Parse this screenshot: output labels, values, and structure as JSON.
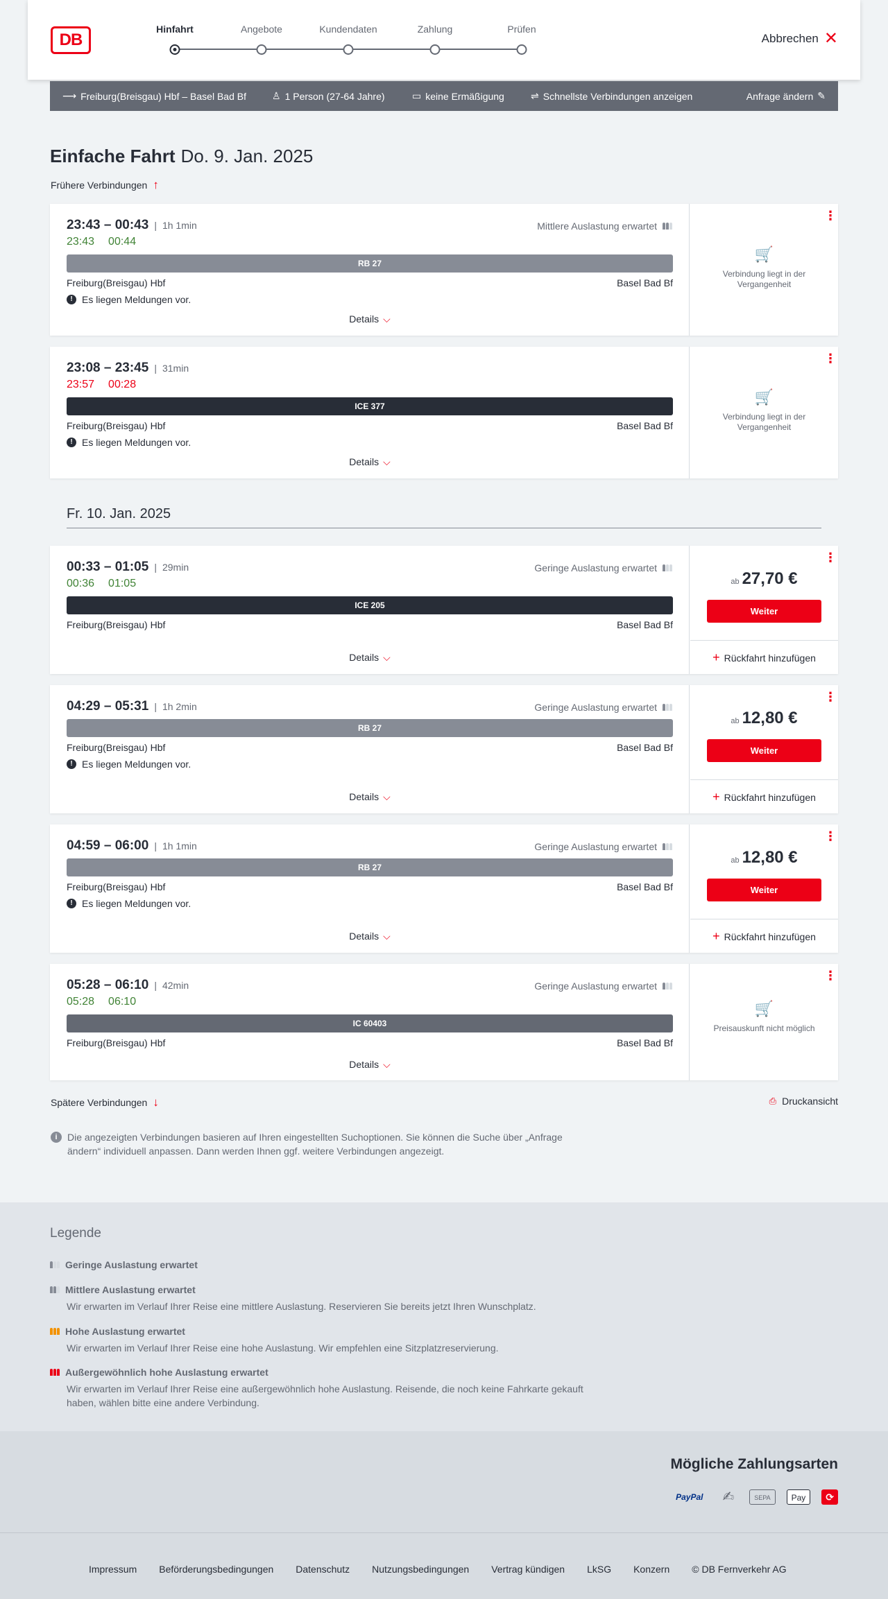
{
  "header": {
    "logo_text": "DB",
    "steps": [
      "Hinfahrt",
      "Angebote",
      "Kundendaten",
      "Zahlung",
      "Prüfen"
    ],
    "cancel_label": "Abbrechen"
  },
  "query": {
    "route": "Freiburg(Breisgau) Hbf – Basel Bad Bf",
    "passengers": "1 Person (27-64 Jahre)",
    "discount": "keine Ermäßigung",
    "fastest": "Schnellste Verbindungen anzeigen",
    "change": "Anfrage ändern"
  },
  "title": {
    "type": "Einfache Fahrt",
    "date": "Do. 9. Jan. 2025"
  },
  "earlier_label": "Frühere Verbindungen",
  "day_separator": "Fr. 10. Jan. 2025",
  "connections": [
    {
      "times": "23:43 – 00:43",
      "duration": "1h 1min",
      "rt_dep": "23:43",
      "rt_arr": "00:44",
      "load": "Mittlere Auslastung erwartet",
      "train": "RB 27",
      "from": "Freiburg(Breisgau) Hbf",
      "to": "Basel Bad Bf",
      "message": "Es liegen Meldungen vor.",
      "details": "Details",
      "status": "Verbindung liegt in der Vergangenheit"
    },
    {
      "times": "23:08 – 23:45",
      "duration": "31min",
      "rt_dep": "23:57",
      "rt_arr": "00:28",
      "train": "ICE 377",
      "from": "Freiburg(Breisgau) Hbf",
      "to": "Basel Bad Bf",
      "message": "Es liegen Meldungen vor.",
      "details": "Details",
      "status": "Verbindung liegt in der Vergangenheit"
    },
    {
      "times": "00:33 – 01:05",
      "duration": "29min",
      "rt_dep": "00:36",
      "rt_arr": "01:05",
      "load": "Geringe Auslastung erwartet",
      "train": "ICE 205",
      "from": "Freiburg(Breisgau) Hbf",
      "to": "Basel Bad Bf",
      "details": "Details",
      "price_prefix": "ab",
      "price": "27,70 €",
      "button": "Weiter",
      "return": "Rückfahrt hinzufügen"
    },
    {
      "times": "04:29 – 05:31",
      "duration": "1h 2min",
      "load": "Geringe Auslastung erwartet",
      "train": "RB 27",
      "from": "Freiburg(Breisgau) Hbf",
      "to": "Basel Bad Bf",
      "message": "Es liegen Meldungen vor.",
      "details": "Details",
      "price_prefix": "ab",
      "price": "12,80 €",
      "button": "Weiter",
      "return": "Rückfahrt hinzufügen"
    },
    {
      "times": "04:59 – 06:00",
      "duration": "1h 1min",
      "load": "Geringe Auslastung erwartet",
      "train": "RB 27",
      "from": "Freiburg(Breisgau) Hbf",
      "to": "Basel Bad Bf",
      "message": "Es liegen Meldungen vor.",
      "details": "Details",
      "price_prefix": "ab",
      "price": "12,80 €",
      "button": "Weiter",
      "return": "Rückfahrt hinzufügen"
    },
    {
      "times": "05:28 – 06:10",
      "duration": "42min",
      "rt_dep": "05:28",
      "rt_arr": "06:10",
      "load": "Geringe Auslastung erwartet",
      "train": "IC 60403",
      "from": "Freiburg(Breisgau) Hbf",
      "to": "Basel Bad Bf",
      "details": "Details",
      "status": "Preisauskunft nicht möglich"
    }
  ],
  "later_label": "Spätere Verbindungen",
  "print_label": "Druckansicht",
  "info_text": "Die angezeigten Verbindungen basieren auf Ihren eingestellten Suchoptionen. Sie können die Suche über „Anfrage ändern“ individuell anpassen. Dann werden Ihnen ggf. weitere Verbindungen angezeigt.",
  "legend": {
    "title": "Legende",
    "items": [
      {
        "title": "Geringe Auslastung erwartet",
        "desc": ""
      },
      {
        "title": "Mittlere Auslastung erwartet",
        "desc": "Wir erwarten im Verlauf Ihrer Reise eine mittlere Auslastung. Reservieren Sie bereits jetzt Ihren Wunschplatz."
      },
      {
        "title": "Hohe Auslastung erwartet",
        "desc": "Wir erwarten im Verlauf Ihrer Reise eine hohe Auslastung. Wir empfehlen eine Sitzplatzreservierung."
      },
      {
        "title": "Außergewöhnlich hohe Auslastung erwartet",
        "desc": "Wir erwarten im Verlauf Ihrer Reise eine außergewöhnlich hohe Auslastung. Reisende, die noch keine Fahrkarte gekauft haben, wählen bitte eine andere Verbindung."
      }
    ]
  },
  "payment": {
    "title": "Mögliche Zahlungsarten",
    "logos": [
      "PayPal",
      "SEPA",
      "Pay"
    ]
  },
  "footer": [
    "Impressum",
    "Beförderungsbedingungen",
    "Datenschutz",
    "Nutzungsbedingungen",
    "Vertrag kündigen",
    "LkSG",
    "Konzern",
    "© DB Fernverkehr AG"
  ],
  "colors": {
    "brand": "#ec0016",
    "ontime": "#408335",
    "text": "#282d37"
  }
}
